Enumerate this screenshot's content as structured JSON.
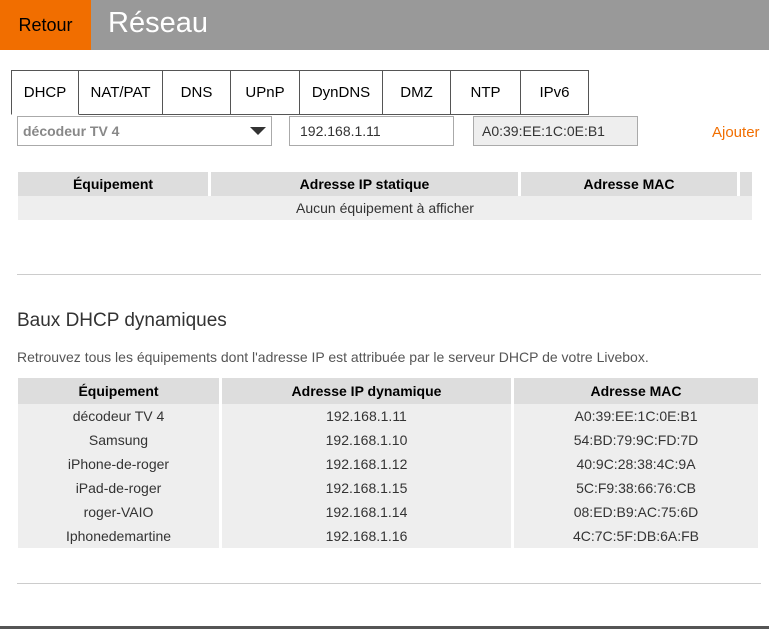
{
  "header": {
    "back_label": "Retour",
    "title": "Réseau"
  },
  "tabs": [
    "DHCP",
    "NAT/PAT",
    "DNS",
    "UPnP",
    "DynDNS",
    "DMZ",
    "NTP",
    "IPv6"
  ],
  "form": {
    "device_select_value": "décodeur TV 4",
    "ip_value": "192.168.1.11",
    "mac_value": "A0:39:EE:1C:0E:B1",
    "add_label": "Ajouter"
  },
  "static_table": {
    "headers": [
      "Équipement",
      "Adresse IP statique",
      "Adresse MAC"
    ],
    "empty_message": "Aucun équipement à afficher"
  },
  "dynamic_section": {
    "title": "Baux DHCP dynamiques",
    "description": "Retrouvez tous les équipements dont l'adresse IP est attribuée par le serveur DHCP de votre Livebox.",
    "headers": [
      "Équipement",
      "Adresse IP dynamique",
      "Adresse MAC"
    ],
    "rows": [
      [
        "décodeur TV 4",
        "192.168.1.11",
        "A0:39:EE:1C:0E:B1"
      ],
      [
        "Samsung",
        "192.168.1.10",
        "54:BD:79:9C:FD:7D"
      ],
      [
        "iPhone-de-roger",
        "192.168.1.12",
        "40:9C:28:38:4C:9A"
      ],
      [
        "iPad-de-roger",
        "192.168.1.15",
        "5C:F9:38:66:76:CB"
      ],
      [
        "roger-VAIO",
        "192.168.1.14",
        "08:ED:B9:AC:75:6D"
      ],
      [
        "Iphonedemartine",
        "192.168.1.16",
        "4C:7C:5F:DB:6A:FB"
      ]
    ]
  },
  "colors": {
    "accent": "#f16e00",
    "header_bg": "#999999"
  }
}
